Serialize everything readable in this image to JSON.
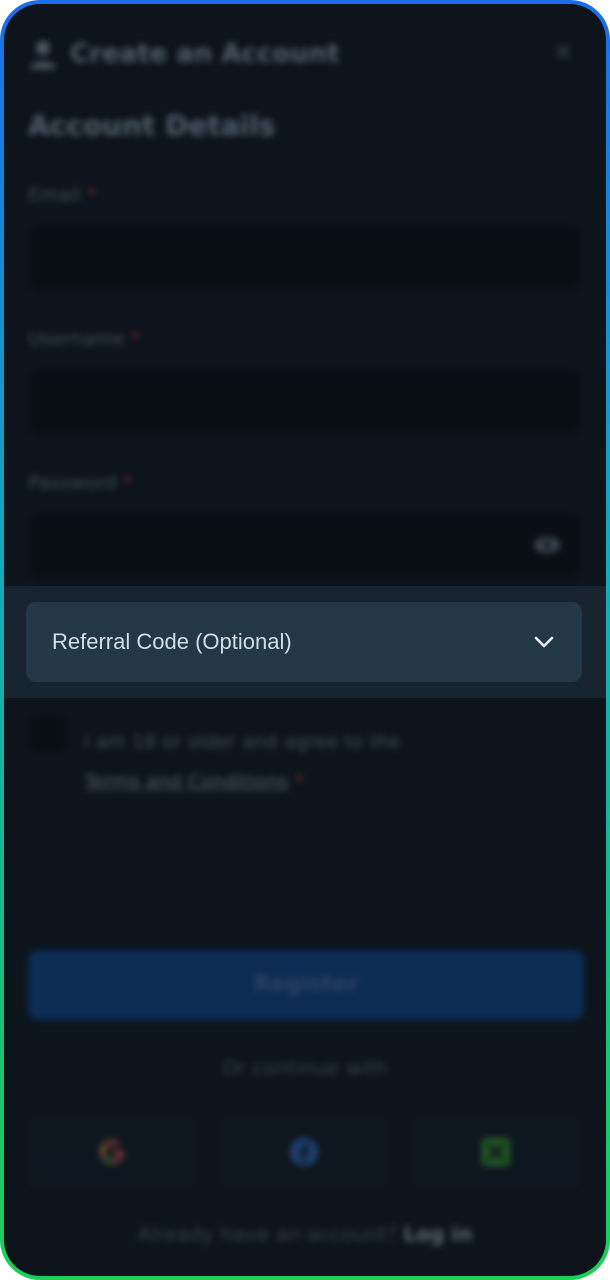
{
  "header": {
    "title": "Create an Account",
    "user_icon": "user-icon",
    "close_icon": "close-icon"
  },
  "section": {
    "title": "Account Details"
  },
  "fields": {
    "email": {
      "label": "Email",
      "required_mark": "*",
      "value": ""
    },
    "username": {
      "label": "Username",
      "required_mark": "*",
      "value": ""
    },
    "password": {
      "label": "Password",
      "required_mark": "*",
      "value": "",
      "toggle_icon": "eye-icon"
    }
  },
  "referral": {
    "label": "Referral Code (Optional)",
    "icon": "chevron-down-icon"
  },
  "terms": {
    "text": "I am 18 or older and agree to the",
    "link": "Terms and Conditions",
    "required_mark": "*"
  },
  "register_button": {
    "label": "Register",
    "color": "#0d3b78"
  },
  "social": {
    "divider_text": "Or continue with",
    "providers": [
      "google-icon",
      "facebook-icon",
      "xbox-icon"
    ]
  },
  "footer": {
    "prompt": "Already have an account?",
    "link": "Log in"
  },
  "colors": {
    "background": "#0d141b",
    "border_top": "#1a6ee8",
    "border_bottom": "#1ccf58",
    "referral_panel": "#223847"
  }
}
